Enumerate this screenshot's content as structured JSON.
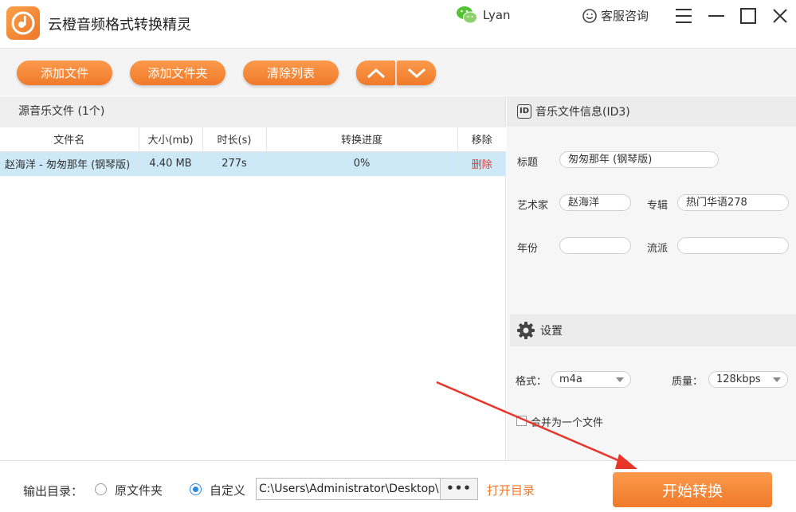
{
  "app": {
    "title": "云橙音频格式转换精灵",
    "user_name": "Lyan",
    "service_label": "客服咨询"
  },
  "toolbar": {
    "add_file": "添加文件",
    "add_folder": "添加文件夹",
    "clear_list": "清除列表"
  },
  "file_panel": {
    "header": "源音乐文件 (1个)",
    "columns": [
      "文件名",
      "大小(mb)",
      "时长(s)",
      "转换进度",
      "移除"
    ],
    "rows": [
      {
        "name": "赵海洋 - 匆匆那年 (钢琴版)",
        "size": "4.40 MB",
        "duration": "277s",
        "progress": "0%",
        "remove": "删除"
      }
    ]
  },
  "id3": {
    "header": "音乐文件信息(ID3)",
    "id_badge": "ID",
    "title_label": "标题",
    "title_value": "匆匆那年 (钢琴版)",
    "artist_label": "艺术家",
    "artist_value": "赵海洋",
    "album_label": "专辑",
    "album_value": "热门华语278",
    "year_label": "年份",
    "year_value": "",
    "genre_label": "流派",
    "genre_value": ""
  },
  "settings": {
    "header": "设置",
    "format_label": "格式：",
    "format_value": "m4a",
    "quality_label": "质量：",
    "quality_value": "128kbps",
    "merge_label": "合并为一个文件",
    "merge_checked": false
  },
  "output": {
    "label": "输出目录：",
    "option_original": "原文件夹",
    "option_custom": "自定义",
    "selected": "自定义",
    "path": "C:\\Users\\Administrator\\Desktop\\",
    "browse_label": "•••",
    "open_dir": "打开目录",
    "start": "开始转换"
  },
  "colors": {
    "accent": "#f07a2a",
    "selection": "#cde8f6",
    "delete": "#e03b2d",
    "annotation": "#e8352a"
  }
}
